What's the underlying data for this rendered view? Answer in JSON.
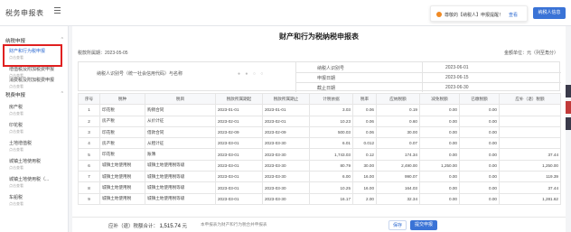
{
  "header": {
    "app_title": "税务申报表",
    "notice_text": "尊敬的【纳税人】申报提醒！",
    "notice_link": "查看",
    "account_button": "纳税人信息"
  },
  "sidebar": {
    "group1": "纳税申报",
    "group2": "税费申报",
    "items": [
      {
        "name": "财产和行为税申报",
        "sub": "点击查看"
      },
      {
        "name": "增值税及附加税费申报",
        "sub": "点击查看"
      },
      {
        "name": "消费税及附加税费申报",
        "sub": "点击查看"
      },
      {
        "name": "房产税",
        "sub": "点击查看"
      },
      {
        "name": "印花税",
        "sub": "点击查看"
      },
      {
        "name": "土地增值税",
        "sub": "点击查看"
      },
      {
        "name": "城镇土地使用税",
        "sub": "点击查看"
      },
      {
        "name": "城镇土地使用税（...",
        "sub": "点击查看"
      },
      {
        "name": "车船税",
        "sub": "点击查看"
      }
    ]
  },
  "main": {
    "title": "财产和行为税纳税申报表",
    "period": "税款所属期：2023-05-05",
    "unit": "金额单位：元（列至角分）",
    "taxpayer_label": "纳税人识别号（统一社会信用代码）与名称",
    "signatures": "● ●  ○ ○",
    "info": [
      {
        "k": "纳税人识别号",
        "v": "2023-06-01"
      },
      {
        "k": "申报日期",
        "v": "2023-06-15"
      },
      {
        "k": "截止日期",
        "v": "2023-06-30"
      }
    ],
    "columns": [
      "序号",
      "税种",
      "税目",
      "税款所属期起",
      "税款所属期止",
      "计税依据",
      "税率",
      "应纳税额",
      "减免税额",
      "已缴税额",
      "应补（退）税额"
    ],
    "rows": [
      [
        "1",
        "印花税",
        "购销合同",
        "2023-01-01",
        "2023-01-01",
        "3.03",
        "0.06",
        "0.19",
        "0.00",
        "0.00",
        ""
      ],
      [
        "2",
        "房产税",
        "从价计征",
        "2023-02-01",
        "2023-02-01",
        "10.23",
        "0.06",
        "0.60",
        "0.00",
        "0.00",
        ""
      ],
      [
        "3",
        "印花税",
        "借款合同",
        "2023-02-09",
        "2023-02-09",
        "500.03",
        "0.06",
        "30.00",
        "0.00",
        "0.00",
        ""
      ],
      [
        "4",
        "房产税",
        "从租计征",
        "2023-03-01",
        "2023-03-30",
        "6.01",
        "0.012",
        "0.07",
        "0.00",
        "0.00",
        ""
      ],
      [
        "5",
        "印花税",
        "账簿",
        "2023-03-01",
        "2023-03-30",
        "1,743.03",
        "0.12",
        "174.34",
        "0.00",
        "0.00",
        "37.44"
      ],
      [
        "6",
        "城镇土地使用税",
        "城镇土地使用税等级",
        "2023-03-01",
        "2023-03-30",
        "80.79",
        "30.00",
        "2,490.00",
        "1,250.00",
        "0.00",
        "1,250.00"
      ],
      [
        "7",
        "城镇土地使用税",
        "城镇土地使用税等级",
        "2023-03-01",
        "2023-03-30",
        "6.00",
        "16.00",
        "990.07",
        "0.00",
        "0.00",
        "119.39"
      ],
      [
        "8",
        "城镇土地使用税",
        "城镇土地使用税等级",
        "2023-03-01",
        "2023-03-30",
        "10.25",
        "16.00",
        "164.03",
        "0.00",
        "0.00",
        "37.44"
      ],
      [
        "9",
        "城镇土地使用税",
        "城镇土地使用税等级",
        "2023-03-01",
        "2023-03-30",
        "16.17",
        "2.00",
        "32.34",
        "0.00",
        "0.00",
        "1,281.62"
      ]
    ]
  },
  "footer": {
    "total_label": "应补（退）税额合计：",
    "total_value": "1,515.74",
    "total_suffix": "元",
    "hint": "本申报表为财产和行为税合并申报表",
    "save_label": "保存",
    "submit_label": "提交申报"
  },
  "colors": {
    "accent": "#3a73d6",
    "highlight": "#e02020",
    "notice": "#f08a24",
    "marker_red": "#c23a3a",
    "marker_dark": "#3a3a4a"
  }
}
